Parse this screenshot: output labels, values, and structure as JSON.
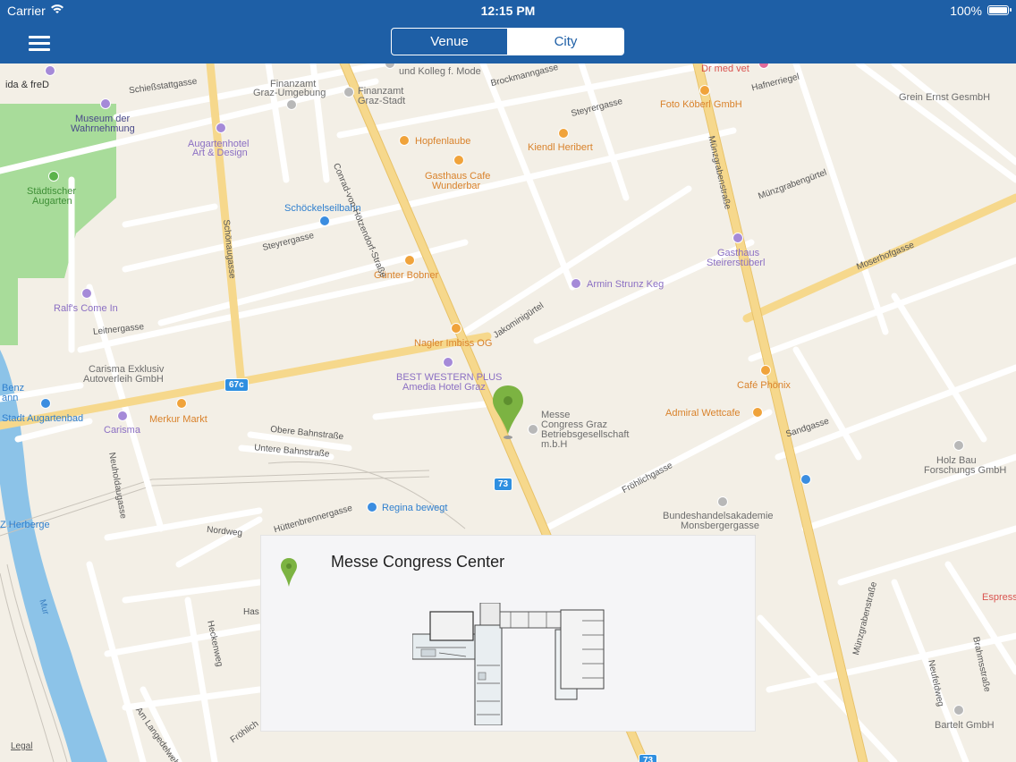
{
  "status_bar": {
    "carrier": "Carrier",
    "time": "12:15 PM",
    "battery": "100%"
  },
  "nav": {
    "segments": [
      "Venue",
      "City"
    ],
    "selected": "City"
  },
  "map": {
    "labels": {
      "ida_fred": "ida & freD",
      "museum1": "Museum der",
      "museum2": "Wahrnehmung",
      "stadtpark1": "Städtischer",
      "stadtpark2": "Augarten",
      "augartenhotel1": "Augartenhotel",
      "augartenhotel2": "Art & Design",
      "finanzamt_umg1": "Finanzamt",
      "finanzamt_umg2": "Graz-Umgebung",
      "finanzamt_st1": "Finanzamt",
      "finanzamt_st2": "Graz-Stadt",
      "kolleg": "und Kolleg f. Mode",
      "drmed": "Dr med vet",
      "grein": "Grein Ernst GesmbH",
      "fotokoberl": "Foto Köberl GmbH",
      "hopfenlaube": "Hopfenlaube",
      "kiendl": "Kiendl Heribert",
      "gasthaus_wunder1": "Gasthaus Cafe",
      "gasthaus_wunder2": "Wunderbar",
      "schockel": "Schöckelseilbahn",
      "gasthaus_steir1": "Gasthaus",
      "gasthaus_steir2": "Steirerstüberl",
      "gunter": "Günter Bobner",
      "armin": "Armin Strunz Keg",
      "ralfs": "Ralf's Come In",
      "nagler": "Nagler Imbiss OG",
      "bestwestern1": "BEST WESTERN PLUS",
      "bestwestern2": "Amedia Hotel Graz",
      "carisma_ex1": "Carisma Exklusiv",
      "carisma_ex2": "Autoverleih GmbH",
      "messe1": "Messe",
      "messe2": "Congress Graz",
      "messe3": "Betriebsgesellschaft",
      "messe4": "m.b.H",
      "cafe_phonix": "Café Phönix",
      "admiral": "Admiral Wettcafe",
      "benz1": "Benz",
      "benz2": "ann",
      "augartenbad": "Stadt Augartenbad",
      "carisma": "Carisma",
      "merkur": "Merkur Markt",
      "holzbau1": "Holz Bau",
      "holzbau2": "Forschungs GmbH",
      "regina": "Regina bewegt",
      "bundeshandels1": "Bundeshandelsakademie",
      "bundeshandels2": "Monsbergergasse",
      "herberge": "Z Herberge",
      "espresso": "Espress",
      "bartelt": "Bartelt GmbH"
    },
    "streets": {
      "schiessstatt": "Schießstattgasse",
      "brockmann": "Brockmanngasse",
      "steyrergasse_top": "Steyrergasse",
      "hafnerriegel": "Hafnerriegel",
      "conrad": "Conrad-von-Hötzendorf-Straße",
      "munzgraben": "Münzgrabenstraße",
      "munzgrabengurtel": "Münzgrabengürtel",
      "schonau": "Schönaugasse",
      "steyrergasse_mid": "Steyrergasse",
      "moserhof": "Moserhofgasse",
      "jakomini": "Jakominigürtel",
      "leitner": "Leitnergasse",
      "obere": "Obere Bahnstraße",
      "untere": "Untere Bahnstraße",
      "frohlich": "Fröhlichgasse",
      "sandgasse": "Sandgasse",
      "neuholdau": "Neuholdaugasse",
      "huttenbrenner": "Hüttenbrennergasse",
      "nordweg": "Nordweg",
      "mur": "Mur",
      "am_langedelwehr": "Am Langedelwehr",
      "heckenweg": "Heckenweg",
      "frohlich_bottom": "Fröhlich",
      "munzgraben_bottom": "Münzgrabenstraße",
      "neufeldweg": "Neufeldweg",
      "brahms": "Brahmsstraße",
      "has": "Has"
    },
    "badges": {
      "b67c": "67c",
      "b73": "73",
      "b73b": "73"
    },
    "legal": "Legal"
  },
  "card": {
    "title": "Messe Congress Center",
    "pin_color": "#7cb342"
  },
  "colors": {
    "nav": "#1e5fa6",
    "pin": "#7cb342",
    "road_major": "#f6d88c",
    "park": "#a8dc9a",
    "river": "#8cc3e8"
  }
}
